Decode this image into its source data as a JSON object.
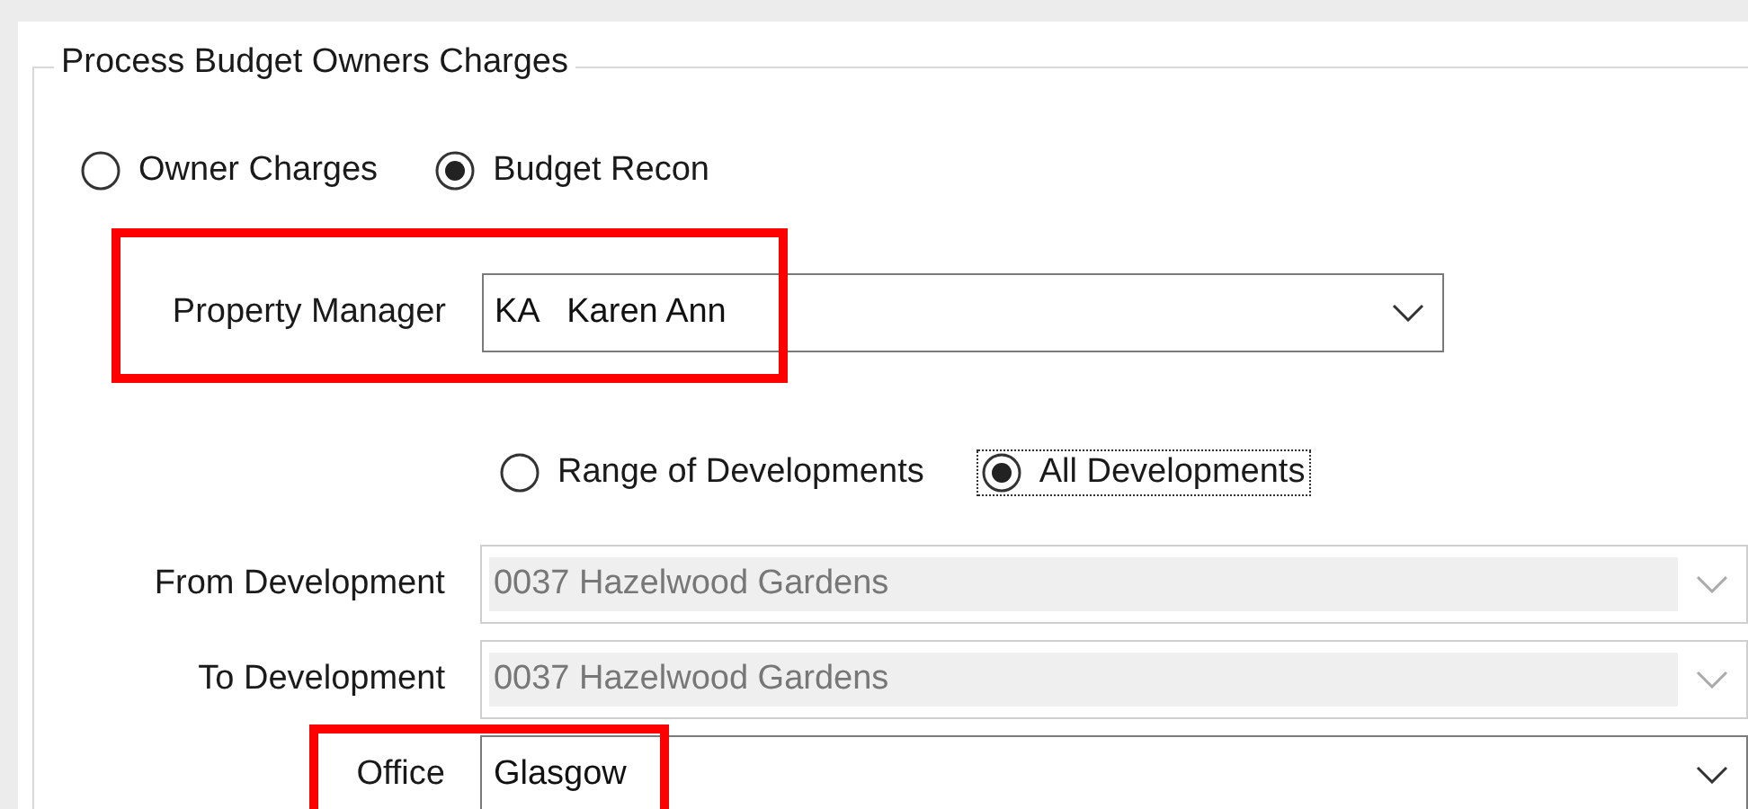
{
  "group": {
    "title": "Process Budget Owners Charges"
  },
  "rows": [
    {
      "kind": "radios",
      "indent": false,
      "options": [
        {
          "label": "Owner Charges",
          "selected": false,
          "focused": false
        },
        {
          "label": "Budget Recon",
          "selected": true,
          "focused": false
        }
      ]
    },
    {
      "kind": "combo",
      "label": "Property Manager",
      "value": "KA   Karen Ann",
      "disabled": false,
      "highlighted": true,
      "wide": false
    },
    {
      "kind": "radios",
      "indent": true,
      "options": [
        {
          "label": "Range of Developments",
          "selected": false,
          "focused": false
        },
        {
          "label": "All Developments",
          "selected": true,
          "focused": true
        }
      ]
    },
    {
      "kind": "combo",
      "label": "From Development",
      "value": "0037 Hazelwood Gardens",
      "disabled": true,
      "highlighted": false,
      "wide": true
    },
    {
      "kind": "combo",
      "label": "To Development",
      "value": "0037 Hazelwood Gardens",
      "disabled": true,
      "highlighted": false,
      "wide": true
    },
    {
      "kind": "combo",
      "label": "Office",
      "value": "Glasgow",
      "disabled": false,
      "highlighted": true,
      "wide": true
    }
  ]
}
